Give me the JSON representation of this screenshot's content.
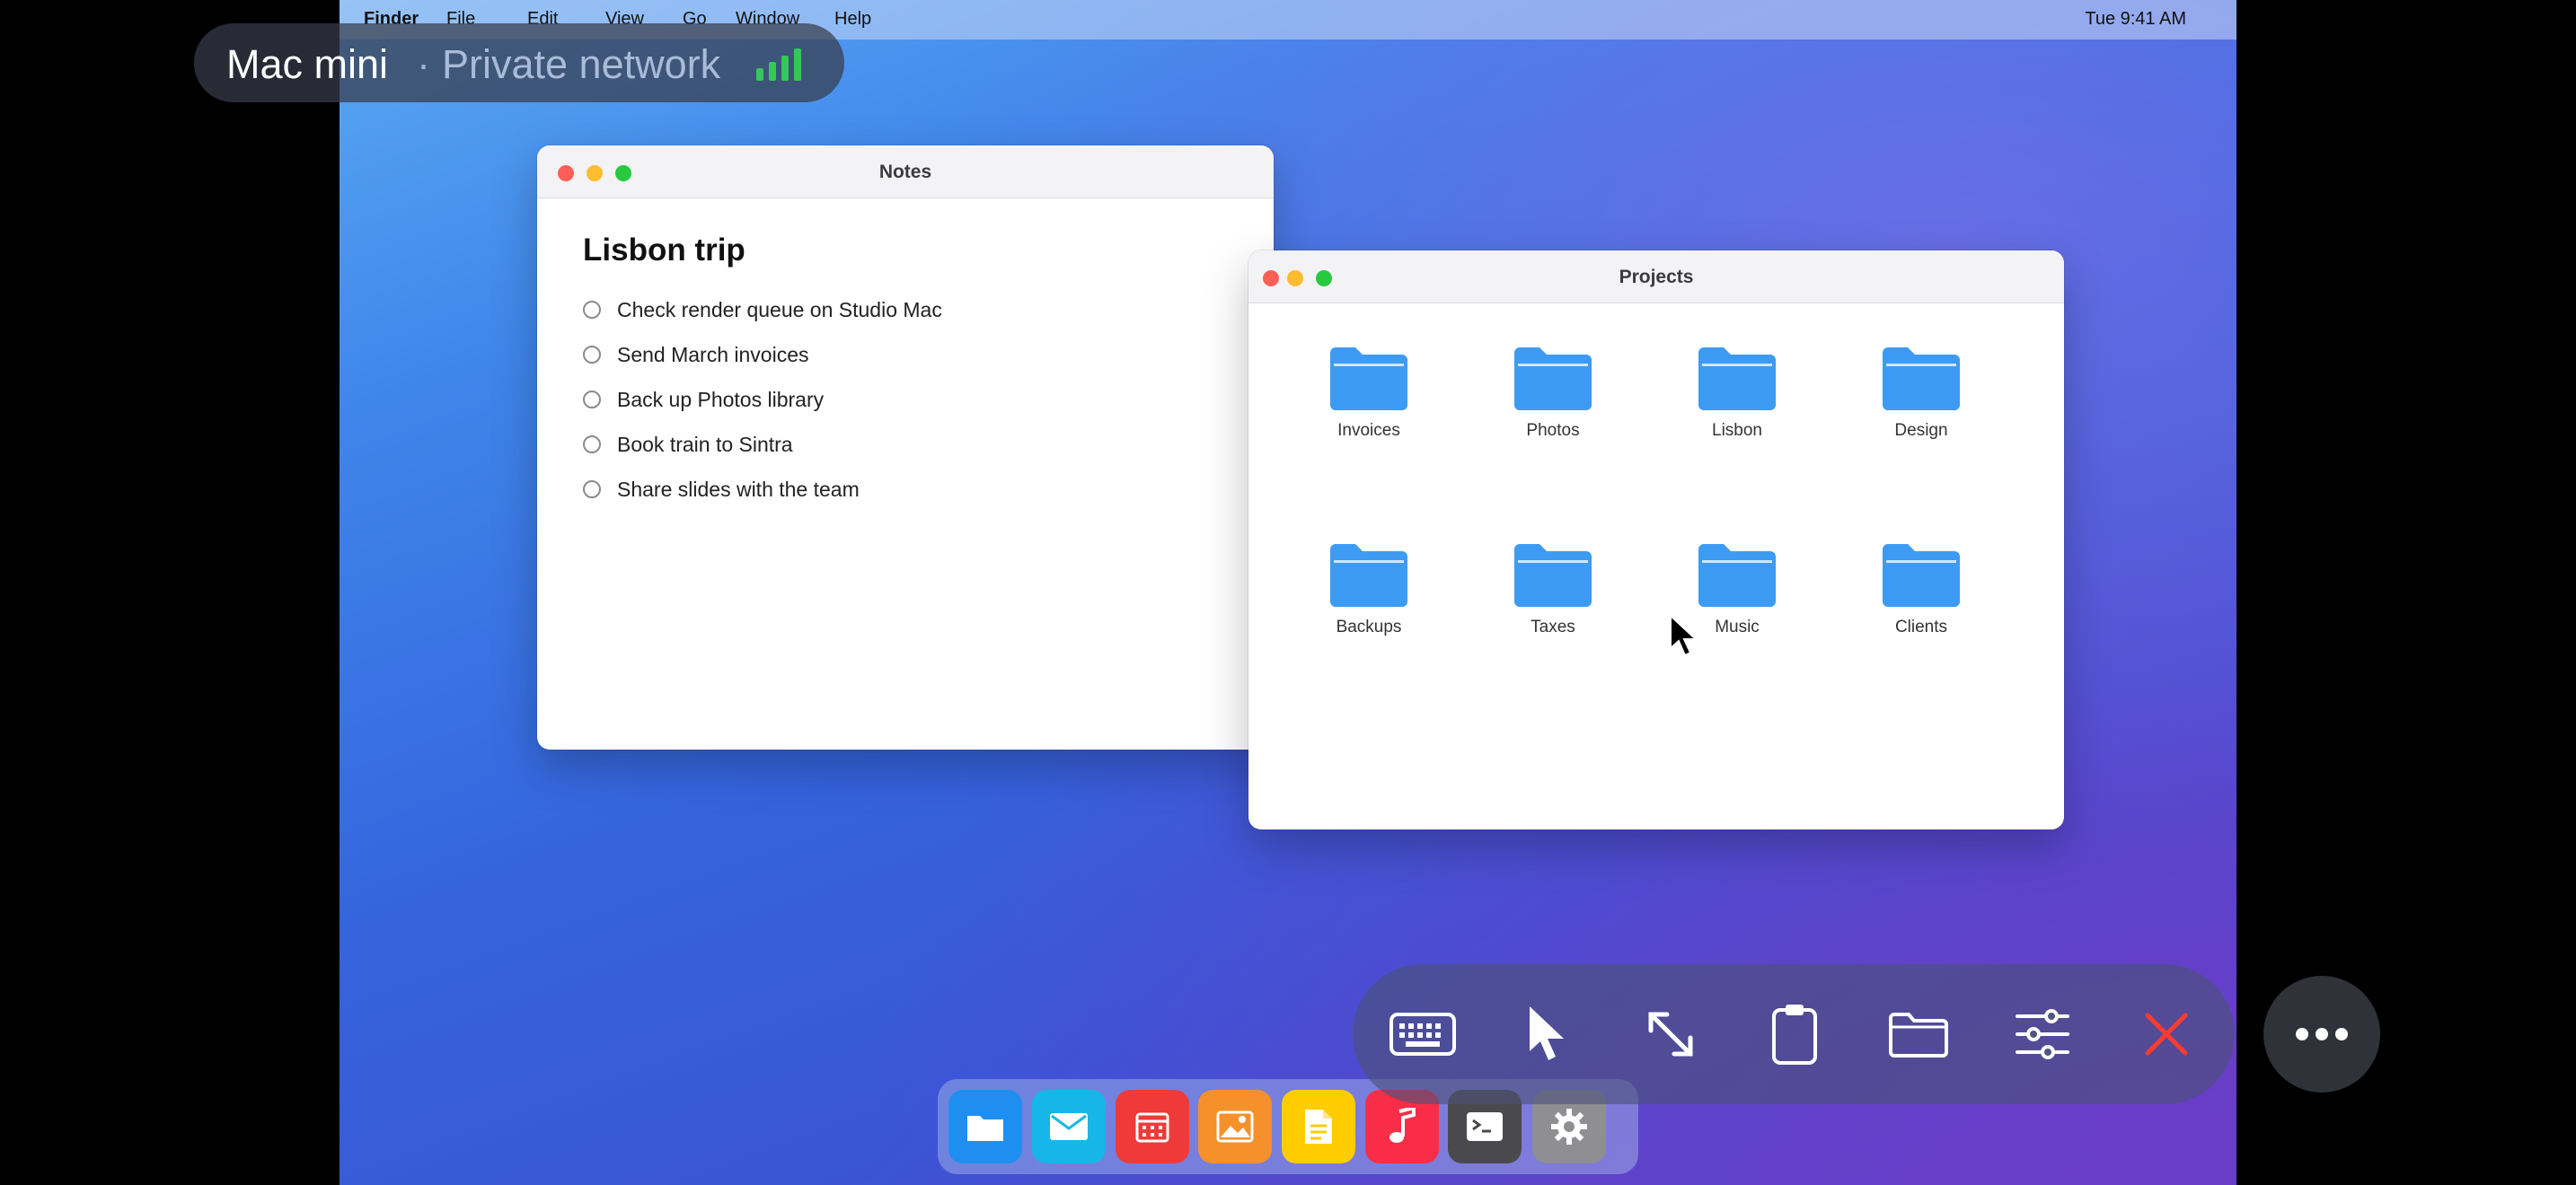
{
  "menubar": {
    "app": "Finder",
    "items": [
      "File",
      "Edit",
      "View",
      "Go",
      "Window",
      "Help"
    ],
    "clock": "Tue 9:41 AM"
  },
  "session": {
    "host": "Mac mini",
    "separator": "·",
    "network": "Private network",
    "signal_icon": "signal-bars-icon",
    "signal_color": "#34c759"
  },
  "notes": {
    "window_title": "Notes",
    "heading": "Lisbon trip",
    "todos": [
      "Check render queue on Studio Mac",
      "Send March invoices",
      "Back up Photos library",
      "Book train to Sintra",
      "Share slides with the team"
    ]
  },
  "projects": {
    "window_title": "Projects",
    "folders": [
      "Invoices",
      "Photos",
      "Lisbon",
      "Design",
      "Backups",
      "Taxes",
      "Music",
      "Clients"
    ],
    "folder_color": "#3d9bf3"
  },
  "toolbar": {
    "buttons": [
      "keyboard-icon",
      "pointer-icon",
      "resize-icon",
      "clipboard-icon",
      "folder-icon",
      "settings-sliders-icon",
      "close-icon"
    ],
    "close_color": "#ff3b30"
  },
  "more_button": "more-icon",
  "dock": {
    "apps": [
      "files-icon",
      "mail-icon",
      "calendar-icon",
      "photos-icon",
      "notes-icon",
      "music-icon",
      "terminal-icon",
      "settings-icon"
    ],
    "colors": [
      "#1e8ff0",
      "#17b6e8",
      "#f03a3a",
      "#f5902a",
      "#ffcc00",
      "#fa2d48",
      "#4a4a4e",
      "#8e8e93"
    ]
  }
}
